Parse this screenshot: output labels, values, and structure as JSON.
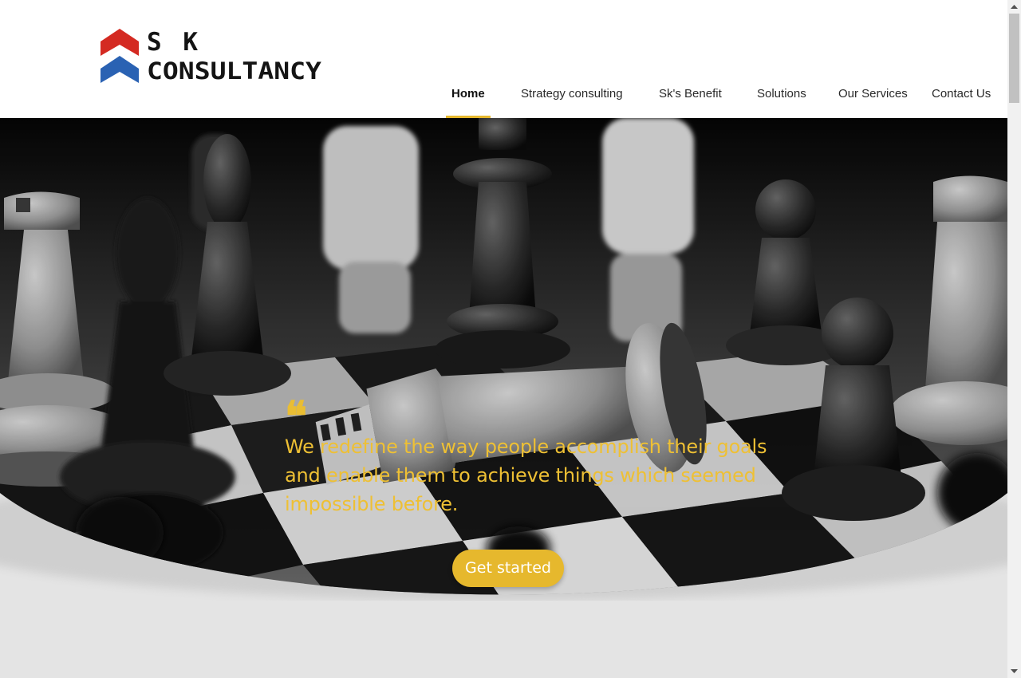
{
  "brand": {
    "line1": "S K",
    "line2": "CONSULTANCY",
    "colors": {
      "red": "#d42a22",
      "blue": "#2a62b3",
      "text": "#141414"
    }
  },
  "nav": {
    "items": [
      {
        "label": "Home",
        "active": true
      },
      {
        "label": "Strategy consulting",
        "active": false
      },
      {
        "label": "Sk's Benefit",
        "active": false
      },
      {
        "label": "Solutions",
        "active": false
      },
      {
        "label": "Our Services",
        "active": false
      },
      {
        "label": "Contact Us",
        "active": false
      }
    ],
    "accent": "#e6b82d"
  },
  "hero": {
    "image": "black-and-white chess board with fallen king",
    "quote_mark": "❝",
    "quote": "We redefine the way people accomplish their goals and enable them to achieve things which seemed impossible before.",
    "cta_label": "Get started",
    "accent": "#e6b82d"
  },
  "icons": [
    "logo-chevron-icon",
    "scroll-up-icon",
    "scroll-down-icon"
  ]
}
